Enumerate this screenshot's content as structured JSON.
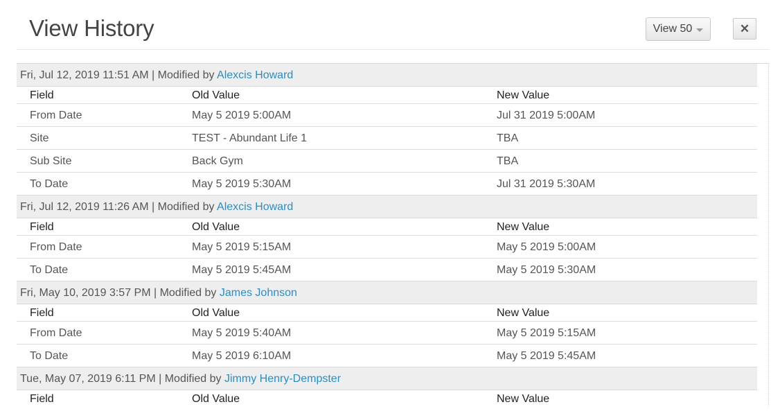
{
  "header": {
    "title": "View History",
    "view_label": "View 50",
    "close_label": "✕"
  },
  "columns": {
    "field": "Field",
    "old": "Old Value",
    "new": "New Value"
  },
  "modified_by_text": "Modified by",
  "groups": [
    {
      "timestamp": "Fri, Jul 12, 2019 11:51 AM",
      "user": "Alexcis Howard",
      "rows": [
        {
          "field": "From Date",
          "old": "May 5 2019 5:00AM",
          "new": "Jul 31 2019 5:00AM"
        },
        {
          "field": "Site",
          "old": "TEST - Abundant Life 1",
          "new": "TBA"
        },
        {
          "field": "Sub Site",
          "old": "Back Gym",
          "new": "TBA"
        },
        {
          "field": "To Date",
          "old": "May 5 2019 5:30AM",
          "new": "Jul 31 2019 5:30AM"
        }
      ]
    },
    {
      "timestamp": "Fri, Jul 12, 2019 11:26 AM",
      "user": "Alexcis Howard",
      "rows": [
        {
          "field": "From Date",
          "old": "May 5 2019 5:15AM",
          "new": "May 5 2019 5:00AM"
        },
        {
          "field": "To Date",
          "old": "May 5 2019 5:45AM",
          "new": "May 5 2019 5:30AM"
        }
      ]
    },
    {
      "timestamp": "Fri, May 10, 2019 3:57 PM",
      "user": "James Johnson",
      "rows": [
        {
          "field": "From Date",
          "old": "May 5 2019 5:40AM",
          "new": "May 5 2019 5:15AM"
        },
        {
          "field": "To Date",
          "old": "May 5 2019 6:10AM",
          "new": "May 5 2019 5:45AM"
        }
      ]
    },
    {
      "timestamp": "Tue, May 07, 2019 6:11 PM",
      "user": "Jimmy Henry-Dempster",
      "rows": []
    }
  ],
  "icons": {
    "close": "close-icon",
    "dropdown": "chevron-down-icon"
  },
  "colors": {
    "link": "#2a8ec5",
    "group_bg": "#eeeeee"
  }
}
